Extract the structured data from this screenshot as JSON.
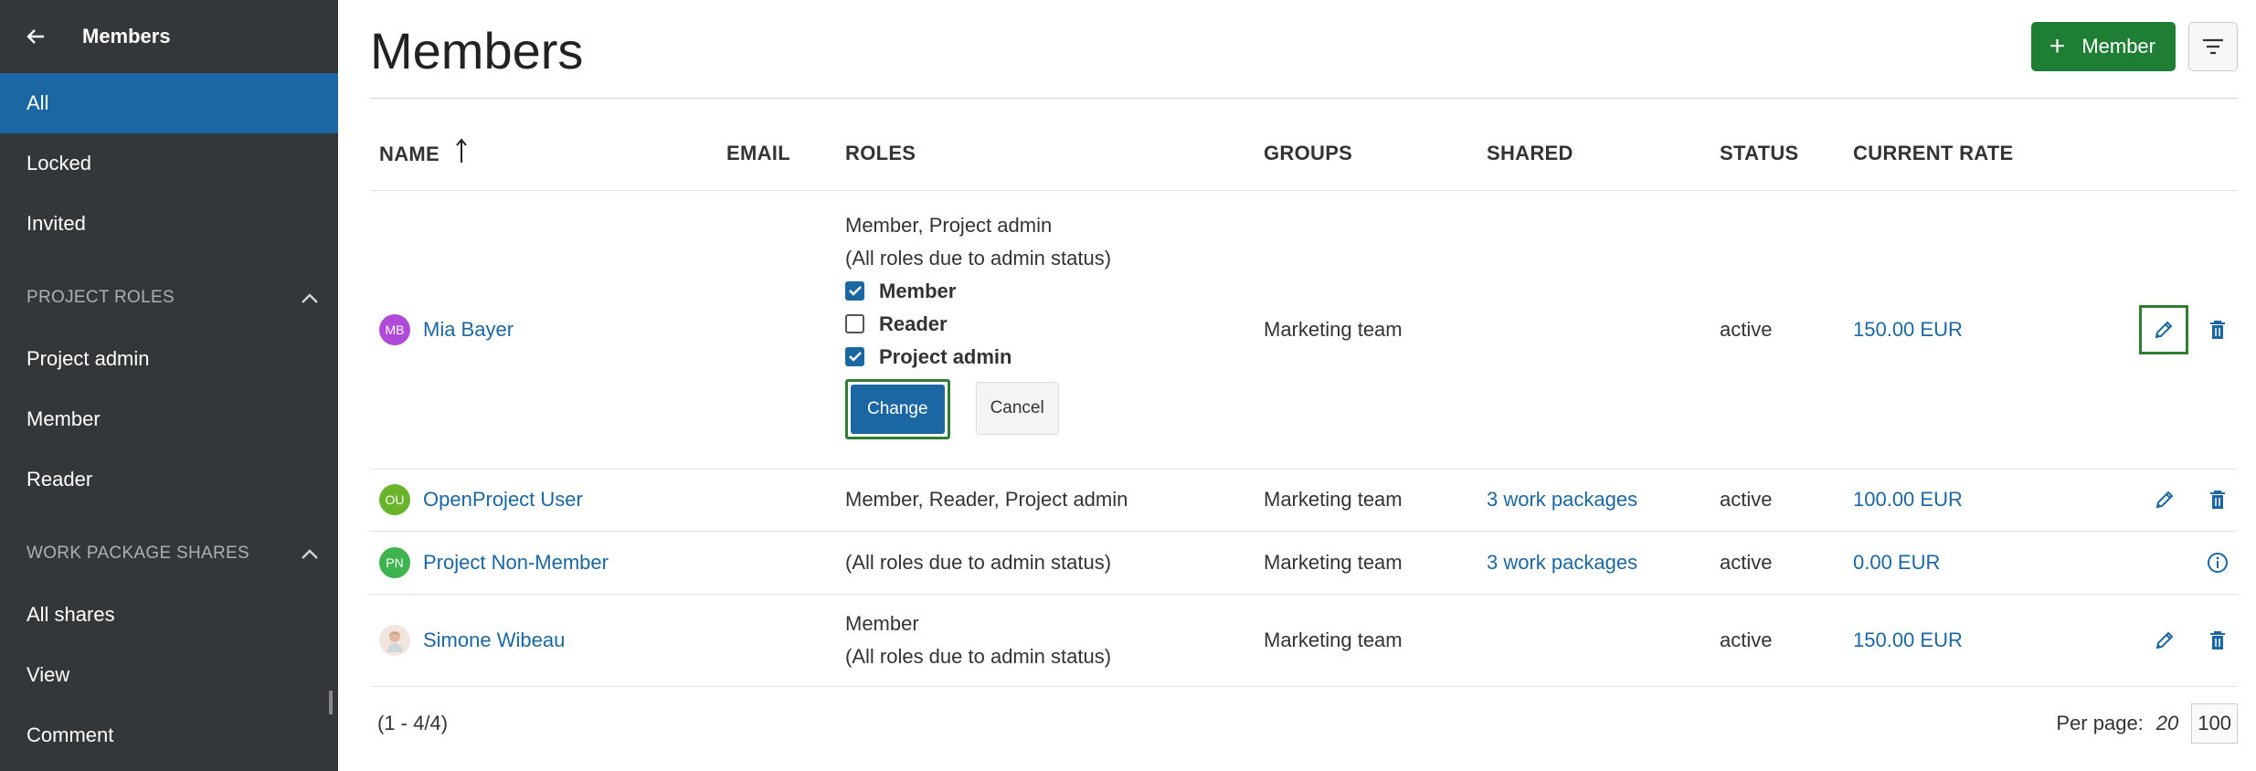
{
  "sidebar": {
    "title": "Members",
    "items": [
      {
        "label": "All"
      },
      {
        "label": "Locked"
      },
      {
        "label": "Invited"
      }
    ],
    "sections": [
      {
        "label": "PROJECT ROLES",
        "items": [
          {
            "label": "Project admin"
          },
          {
            "label": "Member"
          },
          {
            "label": "Reader"
          }
        ]
      },
      {
        "label": "WORK PACKAGE SHARES",
        "items": [
          {
            "label": "All shares"
          },
          {
            "label": "View"
          },
          {
            "label": "Comment"
          }
        ]
      }
    ]
  },
  "header": {
    "title": "Members",
    "add_label": "Member"
  },
  "table": {
    "columns": [
      "NAME",
      "EMAIL",
      "ROLES",
      "GROUPS",
      "SHARED",
      "STATUS",
      "CURRENT RATE"
    ],
    "rows": [
      {
        "initials": "MB",
        "avatar_color": "#b04ad8",
        "name": "Mia Bayer",
        "roles_line1": "Member, Project admin",
        "roles_line2": "(All roles due to admin status)",
        "group": "Marketing team",
        "shared": "",
        "status": "active",
        "rate": "150.00 EUR"
      },
      {
        "initials": "OU",
        "avatar_color": "#6ab42c",
        "name": "OpenProject User",
        "roles_line1": "Member, Reader, Project admin",
        "group": "Marketing team",
        "shared": "3 work packages",
        "status": "active",
        "rate": "100.00 EUR"
      },
      {
        "initials": "PN",
        "avatar_color": "#3fb34f",
        "name": "Project Non-Member",
        "roles_line1": "(All roles due to admin status)",
        "group": "Marketing team",
        "shared": "3 work packages",
        "status": "active",
        "rate": "0.00 EUR"
      },
      {
        "initials": "",
        "avatar_color": "#e8d2c4",
        "name": "Simone Wibeau",
        "roles_line1": "Member",
        "roles_line2": "(All roles due to admin status)",
        "group": "Marketing team",
        "shared": "",
        "status": "active",
        "rate": "150.00 EUR"
      }
    ]
  },
  "role_editor": {
    "options": [
      {
        "label": "Member",
        "checked": true
      },
      {
        "label": "Reader",
        "checked": false
      },
      {
        "label": "Project admin",
        "checked": true
      }
    ],
    "change_label": "Change",
    "cancel_label": "Cancel"
  },
  "footer": {
    "range": "(1 - 4/4)",
    "per_page_label": "Per page:",
    "per_page_options": [
      "20",
      "100"
    ]
  },
  "colors": {
    "accent": "#1a67a3",
    "success": "#1e7e34",
    "sidebar": "#333739"
  }
}
